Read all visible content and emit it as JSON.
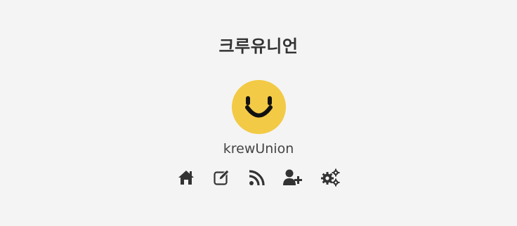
{
  "site": {
    "title": "크루유니언",
    "username": "krewUnion"
  },
  "avatar": {
    "icon": "smiley-face-icon",
    "color": "#f2ca45"
  },
  "nav": [
    {
      "icon": "home-icon"
    },
    {
      "icon": "edit-icon"
    },
    {
      "icon": "rss-icon"
    },
    {
      "icon": "add-user-icon"
    },
    {
      "icon": "settings-gears-icon"
    }
  ],
  "colors": {
    "background": "#f4f4f4",
    "text": "#333333",
    "accent": "#f2ca45"
  }
}
